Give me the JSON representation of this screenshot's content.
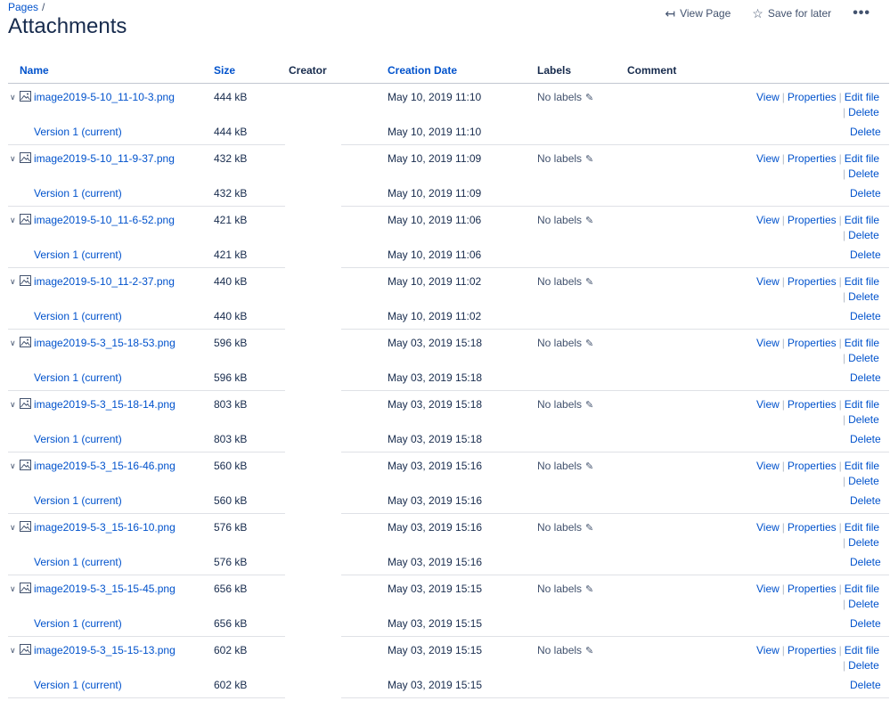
{
  "breadcrumb": {
    "pages": "Pages",
    "separator": "/"
  },
  "page_title": "Attachments",
  "top_actions": {
    "view_page": "View Page",
    "save_for_later": "Save for later",
    "more": "•••"
  },
  "columns": {
    "name": "Name",
    "size": "Size",
    "creator": "Creator",
    "creation_date": "Creation Date",
    "labels": "Labels",
    "comment": "Comment"
  },
  "row_actions": {
    "view": "View",
    "properties": "Properties",
    "edit_file": "Edit file",
    "delete": "Delete",
    "separator": "|",
    "no_labels": "No labels",
    "version_label": "Version 1 (current)"
  },
  "attachments": [
    {
      "name": "image2019-5-10_11-10-3.png",
      "size": "444 kB",
      "date": "May 10, 2019 11:10"
    },
    {
      "name": "image2019-5-10_11-9-37.png",
      "size": "432 kB",
      "date": "May 10, 2019 11:09"
    },
    {
      "name": "image2019-5-10_11-6-52.png",
      "size": "421 kB",
      "date": "May 10, 2019 11:06"
    },
    {
      "name": "image2019-5-10_11-2-37.png",
      "size": "440 kB",
      "date": "May 10, 2019 11:02"
    },
    {
      "name": "image2019-5-3_15-18-53.png",
      "size": "596 kB",
      "date": "May 03, 2019 15:18"
    },
    {
      "name": "image2019-5-3_15-18-14.png",
      "size": "803 kB",
      "date": "May 03, 2019 15:18"
    },
    {
      "name": "image2019-5-3_15-16-46.png",
      "size": "560 kB",
      "date": "May 03, 2019 15:16"
    },
    {
      "name": "image2019-5-3_15-16-10.png",
      "size": "576 kB",
      "date": "May 03, 2019 15:16"
    },
    {
      "name": "image2019-5-3_15-15-45.png",
      "size": "656 kB",
      "date": "May 03, 2019 15:15"
    },
    {
      "name": "image2019-5-3_15-15-13.png",
      "size": "602 kB",
      "date": "May 03, 2019 15:15"
    }
  ]
}
